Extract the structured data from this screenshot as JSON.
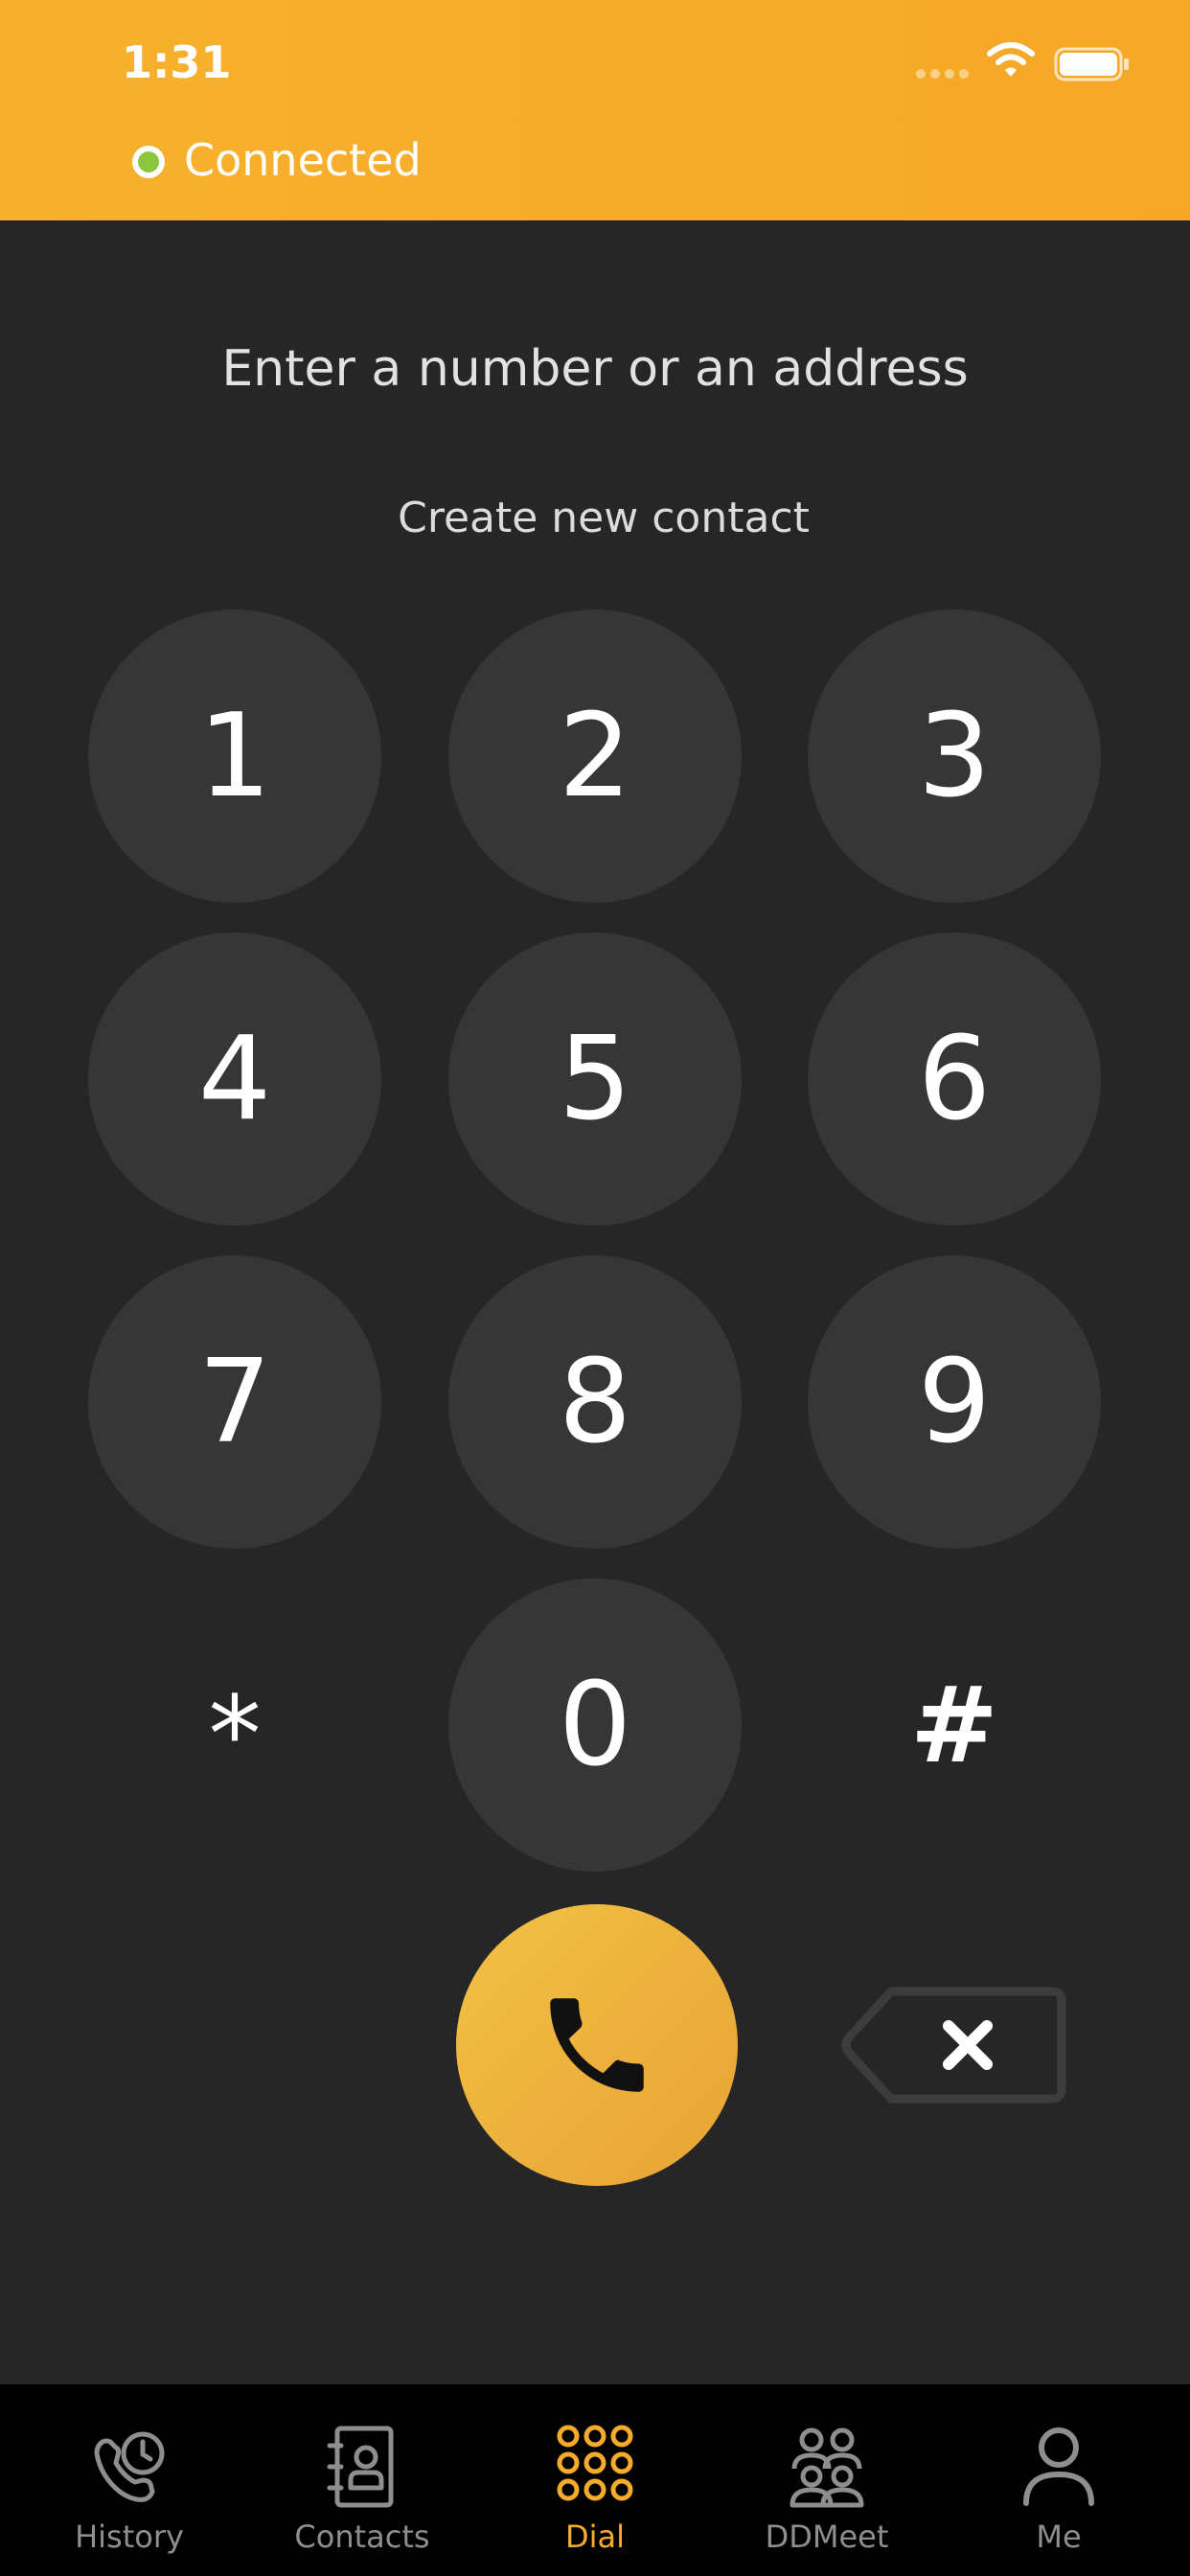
{
  "status_bar": {
    "time": "1:31"
  },
  "connection": {
    "status": "Connected",
    "indicator_color": "#8cc63f"
  },
  "dialer": {
    "placeholder": "Enter a number or an address",
    "create_contact": "Create new contact"
  },
  "keypad": {
    "k1": "1",
    "k2": "2",
    "k3": "3",
    "k4": "4",
    "k5": "5",
    "k6": "6",
    "k7": "7",
    "k8": "8",
    "k9": "9",
    "kstar": "*",
    "k0": "0",
    "khash": "#"
  },
  "actions": {
    "call_icon": "phone-icon",
    "delete_icon": "backspace-icon"
  },
  "tabs": [
    {
      "label": "History",
      "icon": "phone-clock-icon"
    },
    {
      "label": "Contacts",
      "icon": "address-book-icon"
    },
    {
      "label": "Dial",
      "icon": "dialpad-icon",
      "active": true
    },
    {
      "label": "DDMeet",
      "icon": "group-icon"
    },
    {
      "label": "Me",
      "icon": "person-icon"
    }
  ],
  "colors": {
    "accent": "#f6ab2b",
    "background": "#262626",
    "key": "#363636",
    "tab_inactive": "#8e8e8e"
  }
}
